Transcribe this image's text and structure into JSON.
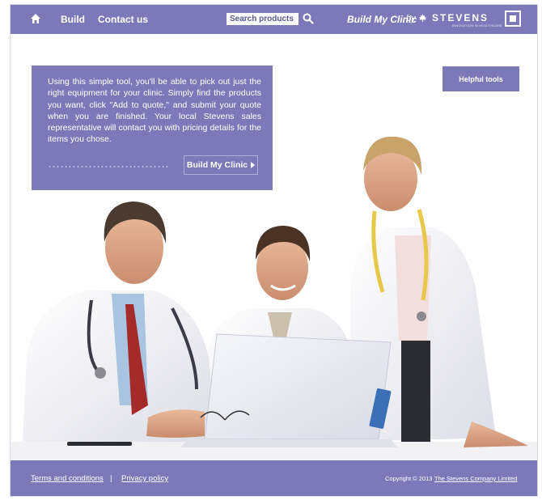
{
  "header": {
    "home_icon": "home-icon",
    "nav": {
      "build": "Build",
      "contact": "Contact us"
    },
    "search": {
      "placeholder": "Search products",
      "icon": "search-icon"
    },
    "title": "Build My Clinic",
    "by": "by",
    "brand": "STEVENS",
    "brand_tagline": "INNOVATION IN HEALTHCARE",
    "brand_icon": "maple-leaf-icon",
    "square_icon": "stop-square-icon"
  },
  "intro": {
    "text": "Using this simple tool, you'll be able to pick out just the right equipment for your clinic. Simply find the products you want, click \"Add to quote,\" and submit your quote when you are finished. Your local Stevens sales representative will contact you with pricing details for the items you chose.",
    "button_label": "Build My Clinic",
    "button_icon": "play-arrow-icon"
  },
  "helpful_tools_label": "Helpful tools",
  "footer": {
    "terms": "Terms and conditions",
    "separator": "|",
    "privacy": "Privacy policy",
    "copyright": "Copyright © 2013",
    "company": "The Stevens Company Limited"
  },
  "colors": {
    "accent": "#7c79b9",
    "text_on_accent": "#ffffff",
    "background": "#ffffff"
  }
}
